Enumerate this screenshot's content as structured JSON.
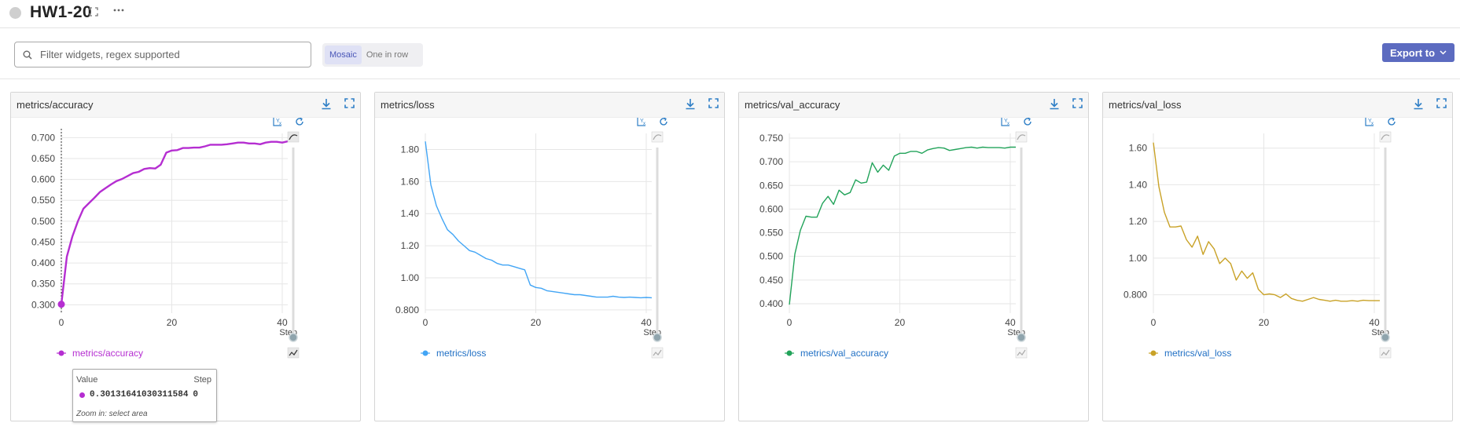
{
  "header": {
    "title": "HW1-20",
    "expand_icon": "expand-icon",
    "more_icon": "more-horizontal-icon"
  },
  "toolbar": {
    "search_placeholder": "Filter widgets, regex supported",
    "search_value": "",
    "layout_options": [
      "Mosaic",
      "One in row"
    ],
    "layout_selected": "Mosaic",
    "export_label": "Export to"
  },
  "colors": {
    "accent": "#5c6bc0",
    "accuracy": "#b52ed1",
    "loss": "#42a5f5",
    "val_accuracy": "#22a35a",
    "val_loss": "#c9a227"
  },
  "chart_data": [
    {
      "type": "line",
      "title": "metrics/accuracy",
      "xlabel": "Step",
      "x_ticks": [
        0,
        20,
        40
      ],
      "xlim": [
        0,
        41
      ],
      "y_ticks": [
        "0.300",
        "0.350",
        "0.400",
        "0.450",
        "0.500",
        "0.550",
        "0.600",
        "0.650",
        "0.700"
      ],
      "ylim": [
        0.28,
        0.71
      ],
      "series": [
        {
          "name": "metrics/accuracy",
          "color": "#b52ed1",
          "x": [
            0,
            1,
            2,
            3,
            4,
            5,
            6,
            7,
            8,
            9,
            10,
            11,
            12,
            13,
            14,
            15,
            16,
            17,
            18,
            19,
            20,
            21,
            22,
            23,
            24,
            25,
            26,
            27,
            28,
            29,
            30,
            31,
            32,
            33,
            34,
            35,
            36,
            37,
            38,
            39,
            40,
            41
          ],
          "y": [
            0.301,
            0.415,
            0.463,
            0.5,
            0.53,
            0.543,
            0.556,
            0.57,
            0.579,
            0.588,
            0.596,
            0.601,
            0.608,
            0.615,
            0.618,
            0.625,
            0.627,
            0.626,
            0.635,
            0.664,
            0.669,
            0.67,
            0.675,
            0.675,
            0.676,
            0.676,
            0.679,
            0.683,
            0.683,
            0.683,
            0.684,
            0.686,
            0.688,
            0.688,
            0.686,
            0.686,
            0.684,
            0.688,
            0.69,
            0.69,
            0.688,
            0.691
          ]
        }
      ],
      "cursor": {
        "step": 0,
        "value": 0.30131641030311584
      }
    },
    {
      "type": "line",
      "title": "metrics/loss",
      "xlabel": "Step",
      "x_ticks": [
        0,
        20,
        40
      ],
      "xlim": [
        0,
        41
      ],
      "y_ticks": [
        "0.800",
        "1.00",
        "1.20",
        "1.40",
        "1.60",
        "1.80"
      ],
      "ylim": [
        0.78,
        1.9
      ],
      "series": [
        {
          "name": "metrics/loss",
          "color": "#42a5f5",
          "x": [
            0,
            1,
            2,
            3,
            4,
            5,
            6,
            7,
            8,
            9,
            10,
            11,
            12,
            13,
            14,
            15,
            16,
            17,
            18,
            19,
            20,
            21,
            22,
            23,
            24,
            25,
            26,
            27,
            28,
            29,
            30,
            31,
            32,
            33,
            34,
            35,
            36,
            37,
            38,
            39,
            40,
            41
          ],
          "y": [
            1.85,
            1.58,
            1.45,
            1.37,
            1.3,
            1.27,
            1.23,
            1.2,
            1.17,
            1.16,
            1.14,
            1.12,
            1.11,
            1.09,
            1.08,
            1.08,
            1.07,
            1.06,
            1.05,
            0.955,
            0.94,
            0.935,
            0.92,
            0.915,
            0.91,
            0.905,
            0.9,
            0.895,
            0.895,
            0.89,
            0.885,
            0.88,
            0.88,
            0.88,
            0.885,
            0.88,
            0.878,
            0.88,
            0.878,
            0.876,
            0.878,
            0.876
          ]
        }
      ]
    },
    {
      "type": "line",
      "title": "metrics/val_accuracy",
      "xlabel": "Step",
      "x_ticks": [
        0,
        20,
        40
      ],
      "xlim": [
        0,
        41
      ],
      "y_ticks": [
        "0.400",
        "0.450",
        "0.500",
        "0.550",
        "0.600",
        "0.650",
        "0.700",
        "0.750"
      ],
      "ylim": [
        0.38,
        0.76
      ],
      "series": [
        {
          "name": "metrics/val_accuracy",
          "color": "#22a35a",
          "x": [
            0,
            1,
            2,
            3,
            4,
            5,
            6,
            7,
            8,
            9,
            10,
            11,
            12,
            13,
            14,
            15,
            16,
            17,
            18,
            19,
            20,
            21,
            22,
            23,
            24,
            25,
            26,
            27,
            28,
            29,
            30,
            31,
            32,
            33,
            34,
            35,
            36,
            37,
            38,
            39,
            40,
            41
          ],
          "y": [
            0.398,
            0.505,
            0.555,
            0.585,
            0.583,
            0.583,
            0.612,
            0.627,
            0.61,
            0.64,
            0.63,
            0.635,
            0.662,
            0.655,
            0.657,
            0.698,
            0.678,
            0.693,
            0.682,
            0.712,
            0.718,
            0.718,
            0.722,
            0.722,
            0.718,
            0.725,
            0.728,
            0.73,
            0.729,
            0.724,
            0.726,
            0.728,
            0.73,
            0.731,
            0.729,
            0.731,
            0.73,
            0.73,
            0.73,
            0.729,
            0.731,
            0.731
          ]
        }
      ]
    },
    {
      "type": "line",
      "title": "metrics/val_loss",
      "xlabel": "Step",
      "x_ticks": [
        0,
        20,
        40
      ],
      "xlim": [
        0,
        41
      ],
      "y_ticks": [
        "0.800",
        "1.00",
        "1.20",
        "1.40",
        "1.60"
      ],
      "ylim": [
        0.7,
        1.68
      ],
      "series": [
        {
          "name": "metrics/val_loss",
          "color": "#c9a227",
          "x": [
            0,
            1,
            2,
            3,
            4,
            5,
            6,
            7,
            8,
            9,
            10,
            11,
            12,
            13,
            14,
            15,
            16,
            17,
            18,
            19,
            20,
            21,
            22,
            23,
            24,
            25,
            26,
            27,
            28,
            29,
            30,
            31,
            32,
            33,
            34,
            35,
            36,
            37,
            38,
            39,
            40,
            41
          ],
          "y": [
            1.63,
            1.39,
            1.25,
            1.17,
            1.17,
            1.175,
            1.1,
            1.06,
            1.12,
            1.02,
            1.09,
            1.05,
            0.97,
            1.0,
            0.97,
            0.88,
            0.93,
            0.89,
            0.92,
            0.83,
            0.8,
            0.805,
            0.8,
            0.785,
            0.805,
            0.78,
            0.77,
            0.765,
            0.775,
            0.785,
            0.775,
            0.77,
            0.765,
            0.77,
            0.765,
            0.765,
            0.768,
            0.765,
            0.77,
            0.768,
            0.768,
            0.768
          ]
        }
      ]
    }
  ],
  "tooltip": {
    "value_header": "Value",
    "step_header": "Step",
    "value": "0.30131641030311584",
    "step": "0",
    "footer": "Zoom in: select area"
  }
}
